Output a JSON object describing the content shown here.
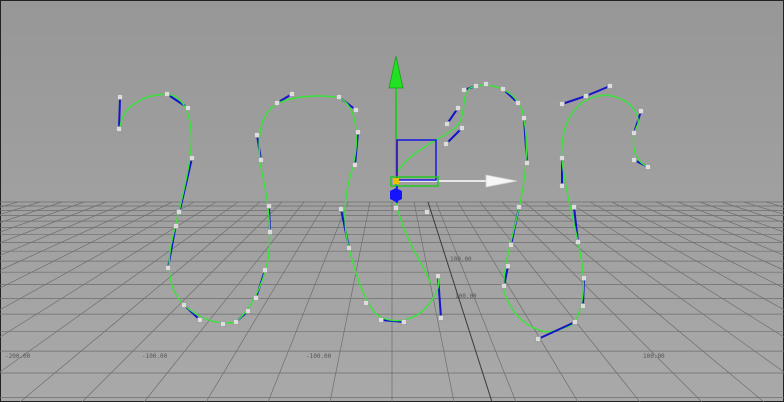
{
  "viewport": {
    "name": "perspective-viewport",
    "background_top": "#9a9a9a",
    "background_bottom": "#aaaaaa",
    "grid_color": "#6e6e6e",
    "curve_color": "#37e437",
    "hull_color": "#1414c8",
    "cv_color": "#dcdcdc",
    "grid_labels": [
      "-200.00",
      "-100.00",
      "100.00",
      "300.00",
      "200.00",
      "300.00"
    ]
  },
  "manipulator": {
    "type": "move-tool",
    "y_axis_color": "#22c822",
    "x_axis_color": "#f2f2f2",
    "z_axis_color": "#1818e0",
    "center_color": "#e8c000"
  }
}
